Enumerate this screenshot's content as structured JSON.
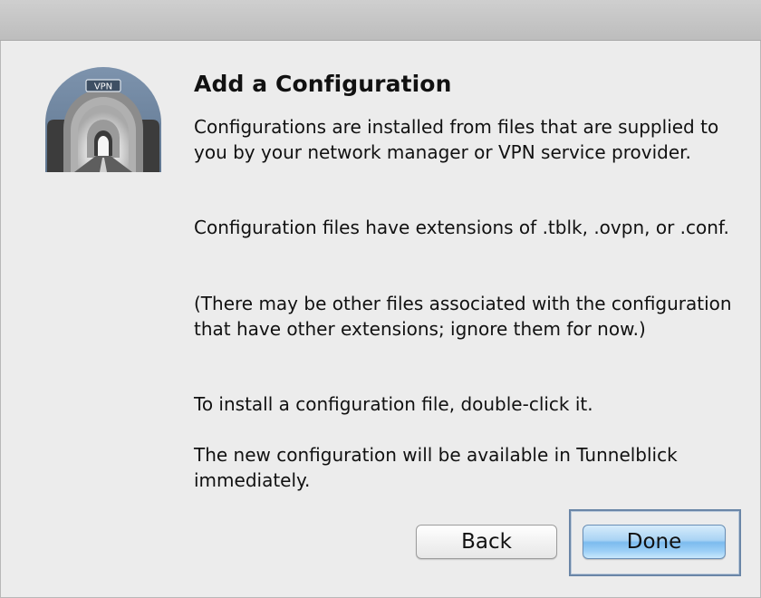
{
  "dialog": {
    "title": "Add a Configuration",
    "icon_label": "VPN",
    "paragraphs": [
      "Configurations are installed from files that are supplied to you by your network manager or VPN service provider.",
      "Configuration files have extensions of .tblk, .ovpn, or .conf.",
      "(There may be other files associated with the configuration that have other extensions; ignore them for now.)",
      "To install a configuration file, double-click it.",
      "The new configuration will be available in Tunnelblick immediately."
    ]
  },
  "buttons": {
    "back_label": "Back",
    "done_label": "Done"
  },
  "icons": {
    "app_icon": "tunnelblick-vpn-tunnel-icon"
  },
  "colors": {
    "window_bg": "#ececec",
    "default_button": "#8ec6f2",
    "focus_ring": "#6a86a7"
  }
}
